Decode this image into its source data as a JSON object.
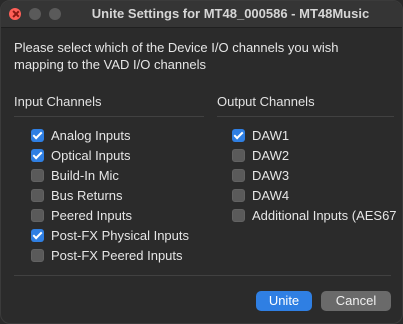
{
  "window": {
    "title": "Unite Settings for MT48_000586 - MT48Music"
  },
  "prompt": {
    "line1": "Please select which of the Device I/O channels you wish",
    "line2": "mapping to the VAD I/O channels"
  },
  "input_channels": {
    "title": "Input Channels",
    "items": [
      {
        "label": "Analog Inputs",
        "checked": true
      },
      {
        "label": "Optical Inputs",
        "checked": true
      },
      {
        "label": "Build-In Mic",
        "checked": false
      },
      {
        "label": "Bus Returns",
        "checked": false
      },
      {
        "label": "Peered Inputs",
        "checked": false
      },
      {
        "label": "Post-FX Physical Inputs",
        "checked": true
      },
      {
        "label": "Post-FX Peered Inputs",
        "checked": false
      }
    ]
  },
  "output_channels": {
    "title": "Output Channels",
    "items": [
      {
        "label": "DAW1",
        "checked": true
      },
      {
        "label": "DAW2",
        "checked": false
      },
      {
        "label": "DAW3",
        "checked": false
      },
      {
        "label": "DAW4",
        "checked": false
      },
      {
        "label": "Additional Inputs (AES67",
        "checked": false
      }
    ]
  },
  "buttons": {
    "unite": "Unite",
    "cancel": "Cancel"
  },
  "colors": {
    "accent": "#2f7fe3",
    "window_bg": "#2b2b2b"
  }
}
